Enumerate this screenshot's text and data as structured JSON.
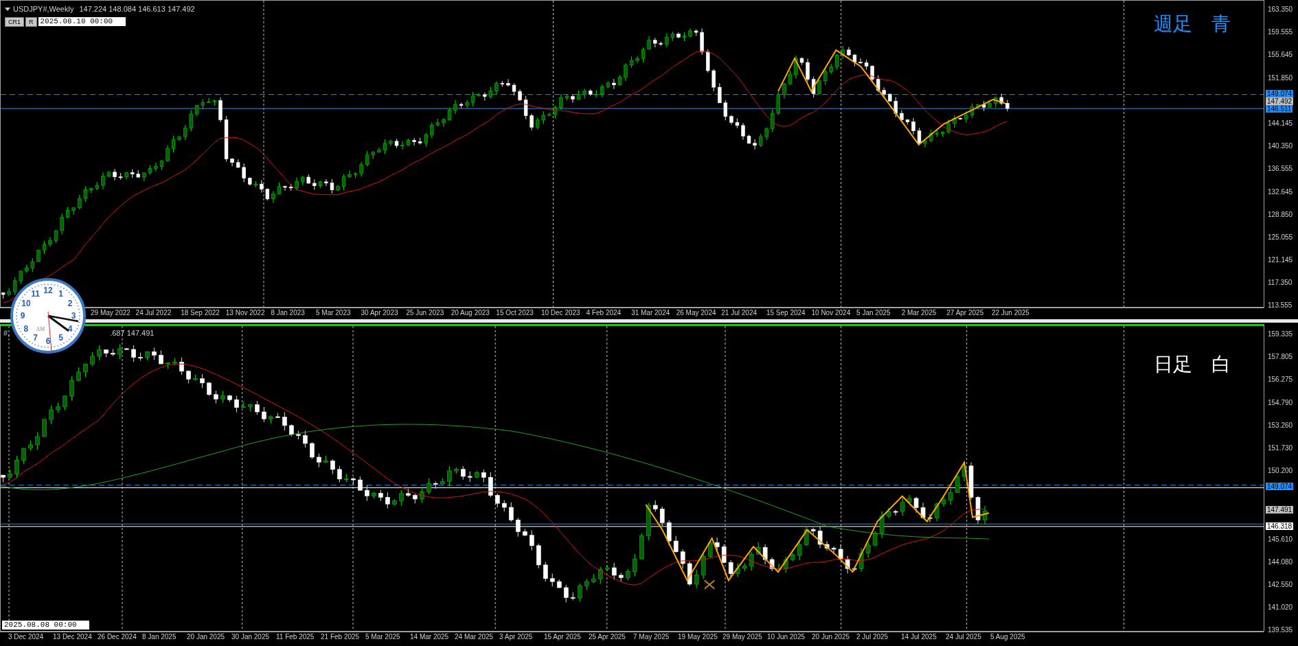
{
  "top_pane": {
    "symbol": "USDJPY#,Weekly",
    "ohlc": "147.224 148.084 146.613 147.492",
    "buttons": [
      "CR1",
      "R"
    ],
    "time_field": "2025.08.10 00:00",
    "overlay_label": "週足　青",
    "price_ticks": [
      "163.350",
      "159.555",
      "155.645",
      "151.850",
      "144.145",
      "140.350",
      "136.555",
      "132.645",
      "128.850",
      "125.055",
      "121.145",
      "117.350",
      "113.555"
    ],
    "price_tags": [
      {
        "text": "149.074",
        "color": "#1e90ff"
      },
      {
        "text": "147.492",
        "color": "#c0c0c0"
      },
      {
        "text": "146.511",
        "color": "#1e90ff"
      }
    ],
    "dates": [
      "29 May 2022",
      "24 Jul 2022",
      "18 Sep 2022",
      "13 Nov 2022",
      "8 Jan 2023",
      "5 Mar 2023",
      "30 Apr 2023",
      "25 Jun 2023",
      "20 Aug 2023",
      "15 Oct 2023",
      "10 Dec 2023",
      "4 Feb 2024",
      "31 Mar 2024",
      "26 May 2024",
      "21 Jul 2024",
      "15 Sep 2024",
      "10 Nov 2024",
      "5 Jan 2025",
      "2 Mar 2025",
      "27 Apr 2025",
      "22 Jun 2025"
    ]
  },
  "bottom_pane": {
    "symbol_fragment": "#,",
    "ohlc_fragment": ".687 147.491",
    "overlay_label": "日足　白",
    "time_field": "2025.08.08 00:00",
    "price_ticks": [
      "159.335",
      "157.805",
      "156.275",
      "154.790",
      "153.260",
      "151.730",
      "150.200",
      "145.610",
      "144.080",
      "142.550",
      "141.020",
      "139.535"
    ],
    "price_tags": [
      {
        "text": "149.074",
        "color": "#1e90ff"
      },
      {
        "text": "147.491",
        "color": "#c0c0c0"
      },
      {
        "text": "146.318",
        "color": "#ffffff"
      }
    ],
    "dates": [
      "3 Dec 2024",
      "13 Dec 2024",
      "26 Dec 2024",
      "8 Jan 2025",
      "20 Jan 2025",
      "30 Jan 2025",
      "11 Feb 2025",
      "21 Feb 2025",
      "5 Mar 2025",
      "14 Mar 2025",
      "24 Mar 2025",
      "3 Apr 2025",
      "15 Apr 2025",
      "25 Apr 2025",
      "7 May 2025",
      "19 May 2025",
      "29 May 2025",
      "10 Jun 2025",
      "20 Jun 2025",
      "2 Jul 2025",
      "14 Jul 2025",
      "24 Jul 2025",
      "5 Aug 2025"
    ]
  },
  "clock": {
    "numerals": [
      "12",
      "11",
      "1",
      "10",
      "2",
      "9",
      "3",
      "8",
      "4",
      "7",
      "5",
      "6"
    ],
    "meridiem": "AM"
  }
}
